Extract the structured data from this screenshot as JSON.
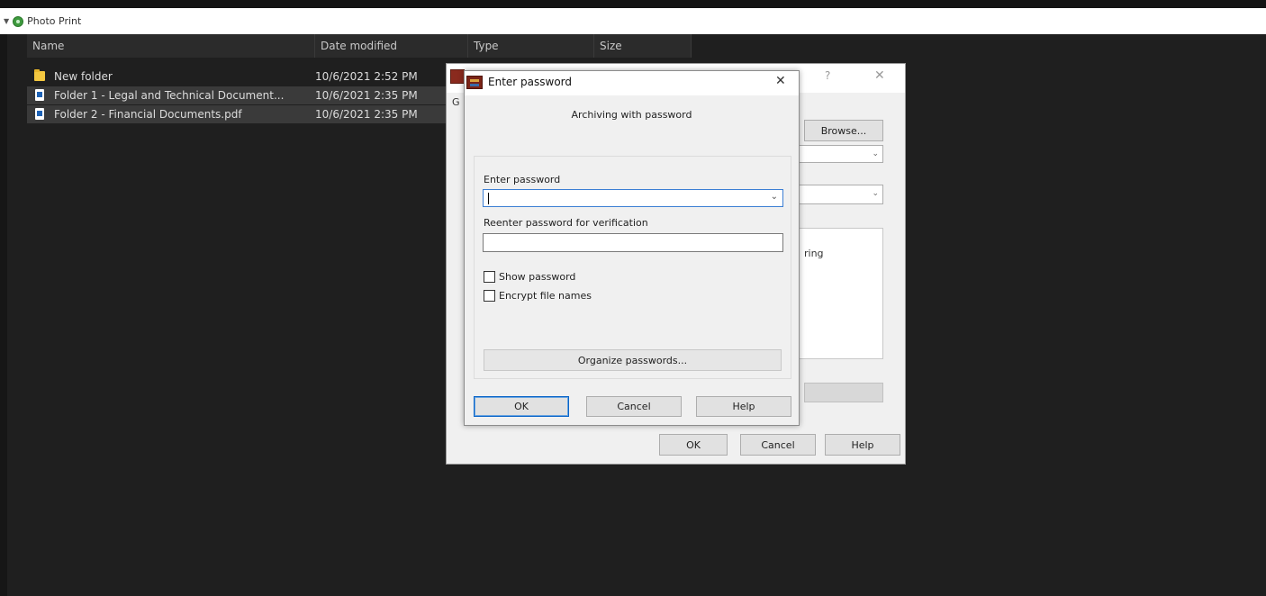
{
  "breadcrumb": {
    "label": "Photo Print"
  },
  "columns": {
    "name": "Name",
    "date_modified": "Date modified",
    "type": "Type",
    "size": "Size"
  },
  "files": [
    {
      "name": "New folder",
      "date": "10/6/2021 2:52 PM",
      "icon": "folder-icon",
      "selected": false
    },
    {
      "name": "Folder 1 - Legal and Technical Document...",
      "date": "10/6/2021 2:35 PM",
      "icon": "pdf-icon",
      "selected": true
    },
    {
      "name": "Folder 2 - Financial Documents.pdf",
      "date": "10/6/2021 2:35 PM",
      "icon": "pdf-icon",
      "selected": true
    }
  ],
  "back_dialog": {
    "help_glyph": "?",
    "close_glyph": "✕",
    "partial_letter": "G",
    "browse_label": "Browse...",
    "partial_text": "ring",
    "ok_label": "OK",
    "cancel_label": "Cancel",
    "help_label": "Help"
  },
  "password_dialog": {
    "title": "Enter password",
    "close_glyph": "✕",
    "subtitle": "Archiving with password",
    "enter_label": "Enter password",
    "enter_value": "",
    "reenter_label": "Reenter password for verification",
    "reenter_value": "",
    "show_password_label": "Show password",
    "show_password_checked": false,
    "encrypt_names_label": "Encrypt file names",
    "encrypt_names_checked": false,
    "organize_label": "Organize passwords...",
    "ok_label": "OK",
    "cancel_label": "Cancel",
    "help_label": "Help"
  },
  "colors": {
    "explorer_bg": "#1f1f1f",
    "selection": "#3a3a3a",
    "focus_blue": "#0a64c8"
  }
}
